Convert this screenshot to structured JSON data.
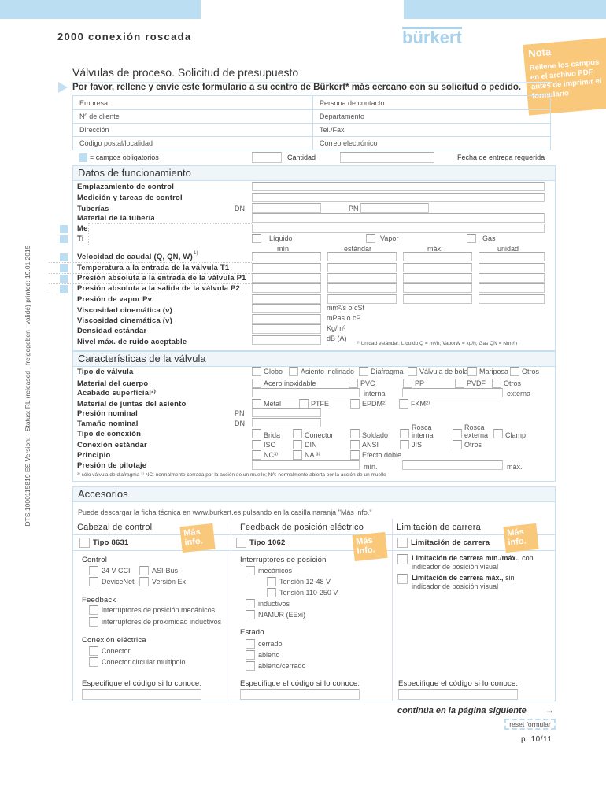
{
  "header": {
    "title": "2000 conexión roscada",
    "logo": "bürkert",
    "colors": {
      "accent": "#bcdef3",
      "note": "#f9c87a"
    }
  },
  "note": {
    "title": "Nota",
    "text": "Rellene los campos en el archivo PDF antes de imprimir el formulario"
  },
  "form": {
    "title": "Válvulas de proceso. Solicitud de presupuesto",
    "intro": "Por favor, rellene y envíe este formulario a su centro de Bürkert* más cercano con su solicitud o pedido."
  },
  "contact": {
    "left": [
      "Empresa",
      "Nº de cliente",
      "Dirección",
      "Código postal/localidad"
    ],
    "right": [
      "Persona de contacto",
      "Departamento",
      "Tel./Fax",
      "Correo electrónico"
    ]
  },
  "legend": {
    "required": "= campos obligatorios",
    "quantity": "Cantidad",
    "delivery": "Fecha de entrega requerida"
  },
  "operating": {
    "title": "Datos de funcionamiento",
    "rows": [
      "Emplazamiento de control",
      "Medición y tareas de control",
      "Tuberías",
      "Material de la tubería",
      "Me",
      "Ti"
    ],
    "dn": "DN",
    "pn": "PN",
    "media": [
      "Líquido",
      "Vapor",
      "Gas"
    ],
    "cols": [
      "mín",
      "estándar",
      "máx.",
      "unidad"
    ],
    "grid_rows": [
      "Velocidad de caudal (Q, QN, W)",
      "Temperatura a la entrada de la válvula T1",
      "Presión absoluta a la entrada de la válvula P1",
      "Presión absoluta a la salida de la válvula P2",
      "Presión de vapor Pv"
    ],
    "flow_sup": "1)",
    "single_rows": [
      "Viscosidad cinemática (ν)",
      "Viscosidad cinemática (ν)",
      "Densidad estándar",
      "Nivel máx. de ruido aceptable"
    ],
    "units": [
      "mm²/s o cSt",
      "mPas o cP",
      "Kg/m³",
      "dB (A)"
    ],
    "footnote": "¹⁾ Unidad estándar: Líquido Q = m³/h; VaporW = kg/h; Gas QN = Nm³/h"
  },
  "valve": {
    "title": "Características de la válvula",
    "rows": [
      "Tipo de válvula",
      "Material del cuerpo",
      "Acabado superficial²⁾",
      "Material de juntas del asiento",
      "Presión nominal",
      "Tamaño nominal",
      "Tipo de conexión",
      "Conexión estándar",
      "Principio",
      "Presión de pilotaje"
    ],
    "pn": "PN",
    "dn": "DN",
    "type": [
      "Globo",
      "Asiento inclinado",
      "Diafragma",
      "Válvula de bola",
      "Mariposa",
      "Otros"
    ],
    "body": [
      "Acero inoxidable",
      "PVC",
      "PP",
      "PVDF",
      "Otros"
    ],
    "finish": [
      "interna",
      "externa"
    ],
    "seal": [
      "Metal",
      "PTFE",
      "EPDM²⁾",
      "FKM²⁾"
    ],
    "conn": [
      "Brida",
      "Conector",
      "Soldado",
      "Rosca interna",
      "Rosca externa",
      "Clamp"
    ],
    "std": [
      "ISO",
      "DIN",
      "ANSI",
      "JIS",
      "Otros"
    ],
    "principle": [
      "NC³⁾",
      "NA ³⁾",
      "Efecto doble"
    ],
    "pilot": [
      "mín.",
      "máx."
    ],
    "footnote": "²⁾ sólo válvula de diafragma ³⁾ NC: normalmente cerrada por la acción de un muelle; NA: normalmente abierta por la acción de un muelle"
  },
  "accessories": {
    "title": "Accesorios",
    "info": "Puede descargar la ficha técnica en www.burkert.es pulsando en la casilla naranja \"Más info.\"",
    "more": "Más info.",
    "code_label": "Especifique el código si lo conoce:",
    "col1": {
      "title": "Cabezal de control",
      "type": "Tipo 8631",
      "control": "Control",
      "control_opts": [
        "24 V CCI",
        "ASI-Bus",
        "DeviceNet",
        "Versión Ex"
      ],
      "feedback": "Feedback",
      "feedback_opts": [
        "interruptores de posición mecánicos",
        "interruptores de proximidad inductivos"
      ],
      "elec": "Conexión eléctrica",
      "elec_opts": [
        "Conector",
        "Conector circular multipolo"
      ]
    },
    "col2": {
      "title": "Feedback de posición eléctrico",
      "type": "Tipo 1062",
      "switches": "Interruptores de posición",
      "opts": [
        "mecánicos",
        "Tensión 12-48 V",
        "Tensión 110-250 V",
        "inductivos",
        "NAMUR (EExi)"
      ],
      "state": "Estado",
      "state_opts": [
        "cerrado",
        "abierto",
        "abierto/cerrado"
      ]
    },
    "col3": {
      "title": "Limitación de carrera",
      "type": "Limitación de carrera",
      "opt1_bold": "Limitación de carrera mín./máx.,",
      "opt1_rest": " con",
      "opt1_line2": "indicador de posición visual",
      "opt2_bold": "Limitación de carrera máx.,",
      "opt2_rest": " sin",
      "opt2_line2": "indicador de posición visual"
    }
  },
  "footer": {
    "continue": "continúa en la página siguiente",
    "reset": "reset formular",
    "page": "p. 10/11"
  },
  "side": "DTS 1000115819 ES Version: - Status: RL (released | freigegeben | validé) printed: 19.01.2015"
}
